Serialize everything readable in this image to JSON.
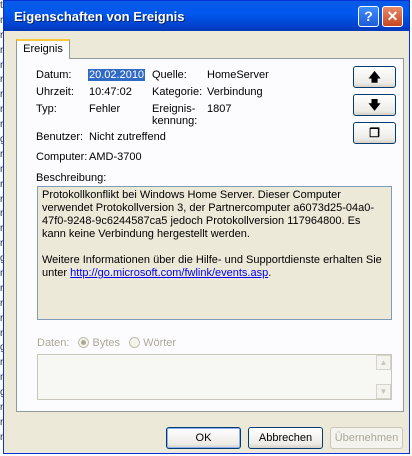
{
  "window": {
    "title": "Eigenschaften von Ereignis",
    "help_glyph": "?",
    "close_glyph": "✕"
  },
  "tabs": [
    {
      "label": "Ereignis"
    }
  ],
  "fields": {
    "datum_label": "Datum:",
    "datum_value": "20.02.2010",
    "uhrzeit_label": "Uhrzeit:",
    "uhrzeit_value": "10:47:02",
    "typ_label": "Typ:",
    "typ_value": "Fehler",
    "benutzer_label": "Benutzer:",
    "benutzer_value": "Nicht zutreffend",
    "computer_label": "Computer:",
    "computer_value": "AMD-3700",
    "quelle_label": "Quelle:",
    "quelle_value": "HomeServer",
    "kategorie_label": "Kategorie:",
    "kategorie_value": "Verbindung",
    "kennung_label_1": "Ereignis-",
    "kennung_label_2": "kennung:",
    "kennung_value": "1807"
  },
  "nav": {
    "up_glyph": "🡅",
    "down_glyph": "🡇",
    "copy_glyph": "❐"
  },
  "description": {
    "label": "Beschreibung:",
    "text": "Protokollkonflikt bei Windows Home Server. Dieser Computer verwendet Protokollversion 3, der Partnercomputer a6073d25-04a0-47f0-9248-9c6244587ca5 jedoch Protokollversion 117964800. Es kann keine Verbindung hergestellt werden.",
    "more_text": "Weitere Informationen über die Hilfe- und Supportdienste erhalten Sie unter ",
    "link": "http://go.microsoft.com/fwlink/events.asp",
    "link_suffix": "."
  },
  "data_section": {
    "label": "Daten:",
    "option_bytes": "Bytes",
    "option_words": "Wörter",
    "selected": "Bytes"
  },
  "buttons": {
    "ok": "OK",
    "cancel": "Abbrechen",
    "apply": "Übernehmen"
  },
  "background_fragments": [
    "ti",
    "re",
    "re",
    "re",
    "re",
    "re",
    "re",
    "re",
    "re",
    "ge",
    "re",
    "re",
    "re",
    "re",
    "re",
    "re",
    "re",
    "ge",
    "re",
    "re",
    "re",
    "re",
    "re",
    "ge",
    "re",
    "re",
    "ge",
    "re",
    "re",
    "re"
  ]
}
